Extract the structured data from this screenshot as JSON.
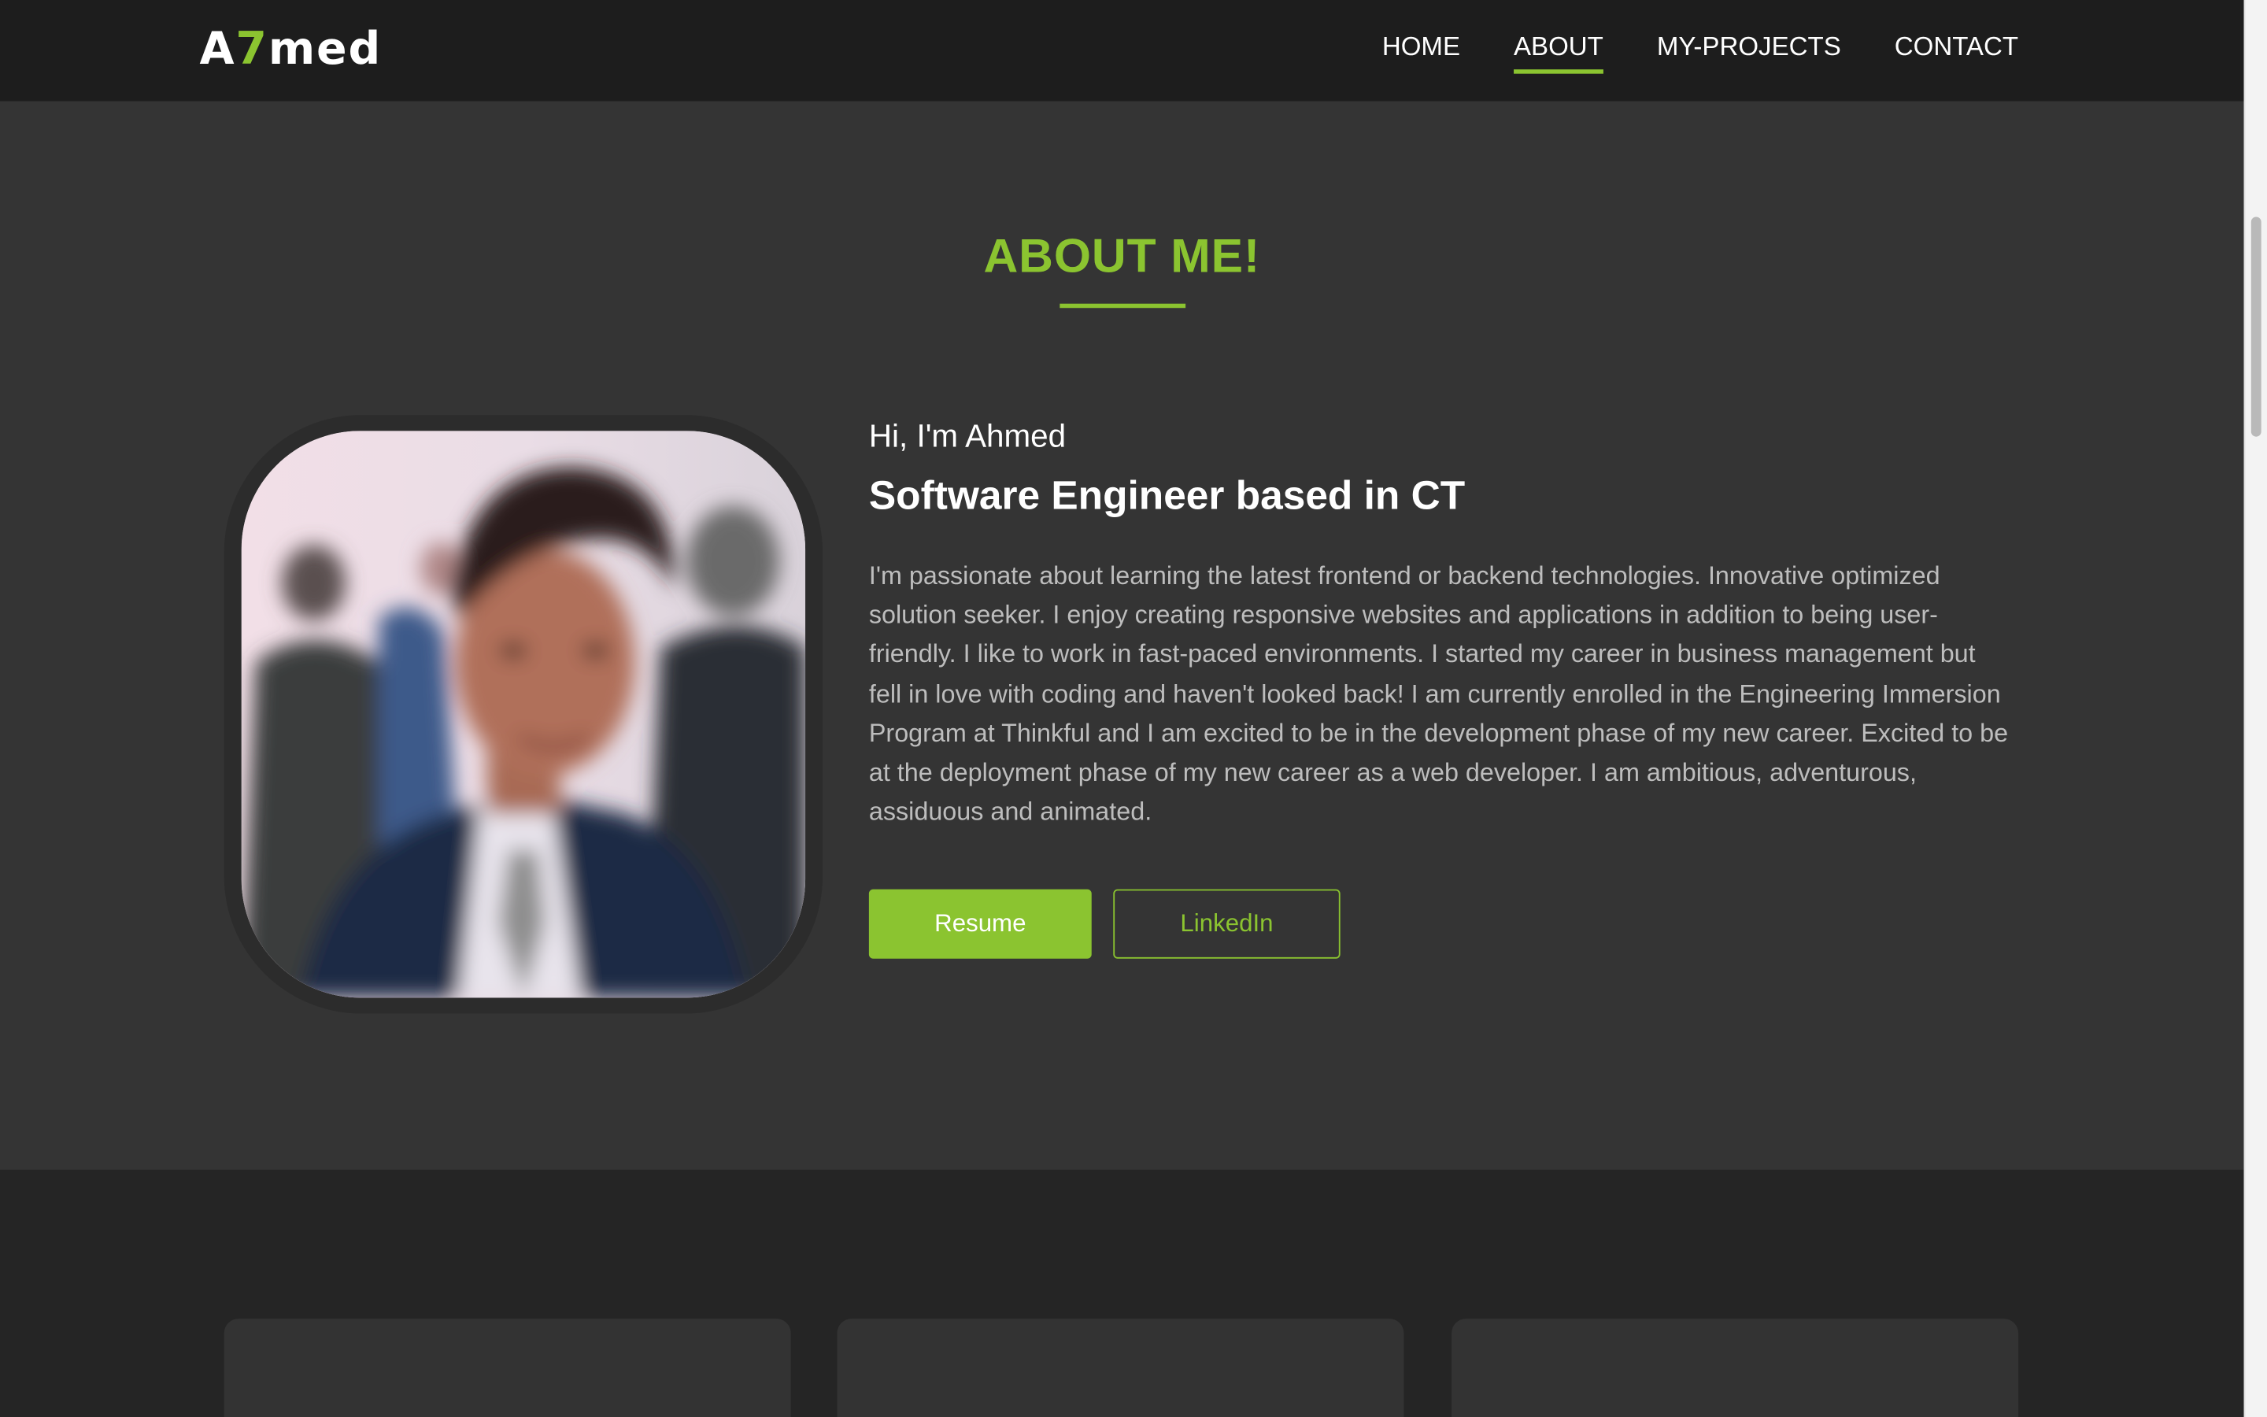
{
  "brand": {
    "prefix": "A",
    "accent": "7",
    "suffix": "med"
  },
  "nav": {
    "items": [
      {
        "label": "HOME"
      },
      {
        "label": "ABOUT"
      },
      {
        "label": "MY-PROJECTS"
      },
      {
        "label": "CONTACT"
      }
    ],
    "active": "ABOUT"
  },
  "about": {
    "title": "ABOUT ME!",
    "greeting": "Hi, I'm Ahmed",
    "role": "Software Engineer based in CT",
    "bio": "I'm passionate about learning the latest frontend or backend technologies. Innovative optimized solution seeker. I enjoy creating responsive websites and applications in addition to being user-friendly. I like to work in fast-paced environments. I started my career in business management but fell in love with coding and haven't looked back! I am currently enrolled in the Engineering Immersion Program at Thinkful and I am excited to be in the development phase of my new career. Excited to be at the deployment phase of my new career as a web developer. I am ambitious, adventurous, assiduous and animated.",
    "resume_label": "Resume",
    "linkedin_label": "LinkedIn"
  },
  "colors": {
    "accent": "#8bc430",
    "nav_bg": "#1d1d1d",
    "section_bg": "#343434",
    "page_bg": "#252525"
  }
}
